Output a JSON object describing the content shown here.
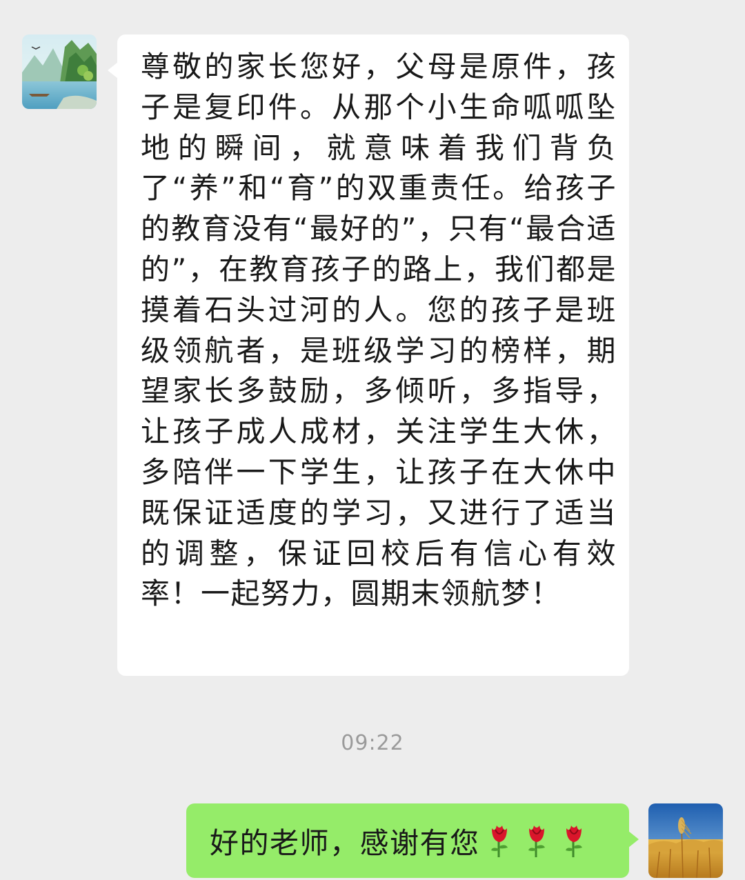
{
  "messages": {
    "incoming": {
      "text": "尊敬的家长您好，父母是原件，孩子是复印件。从那个小生命呱呱坠地的瞬间，就意味着我们背负了“养”和“育”的双重责任。给孩子的教育没有“最好的”，只有“最合适的”，在教育孩子的路上，我们都是摸着石头过河的人。您的孩子是班级领航者，是班级学习的榜样，期望家长多鼓励，多倾听，多指导，让孩子成人成材，关注学生大休，多陪伴一下学生，让孩子在大休中既保证适度的学习，又进行了适当的调整，保证回校后有信心有效率！一起努力，圆期末领航梦！",
      "avatar_icon": "landscape-avatar"
    },
    "timestamp": "09:22",
    "outgoing": {
      "text": "好的老师，感谢有您",
      "emoji": [
        "rose-icon",
        "rose-icon",
        "rose-icon"
      ],
      "avatar_icon": "wheat-field-avatar"
    }
  },
  "colors": {
    "background": "#ededed",
    "incoming_bubble": "#ffffff",
    "outgoing_bubble": "#95ec69",
    "timestamp": "#9a9a9a",
    "text": "#191919"
  }
}
